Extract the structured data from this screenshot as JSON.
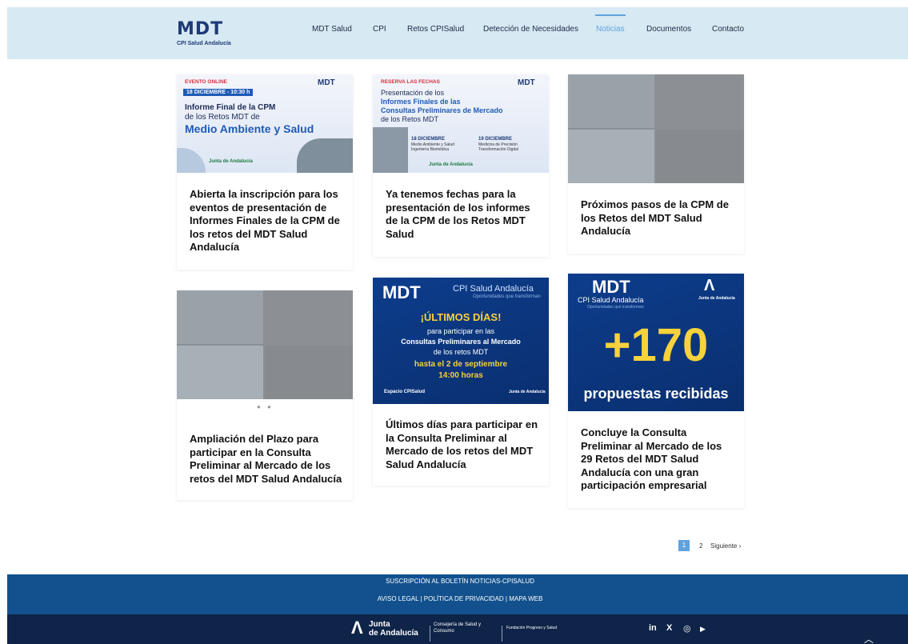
{
  "header": {
    "logo_text": "MDT",
    "logo_subtitle": "CPI Salud Andalucía",
    "nav": [
      {
        "label": "MDT Salud"
      },
      {
        "label": "CPI"
      },
      {
        "label": "Retos CPISalud"
      },
      {
        "label": "Detección de Necesidades"
      },
      {
        "label": "Noticias"
      },
      {
        "label": "Documentos"
      },
      {
        "label": "Contacto"
      }
    ]
  },
  "cards": [
    {
      "title": "Abierta la inscripción para los eventos de presentación de Informes Finales de la CPM de los retos del MDT Salud Andalucía",
      "image": {
        "tag": "EVENTO ONLINE",
        "date": "18 DICIEMBRE - 10:30 h",
        "line1": "Informe Final de la CPM",
        "line2": "de los Retos MDT de",
        "line3": "Medio Ambiente y Salud",
        "brand": "MDT",
        "footer": "Junta de Andalucía"
      }
    },
    {
      "title": "Ya tenemos fechas para la presentación de los informes de la CPM de los Retos MDT Salud",
      "image": {
        "tag": "RESERVA LAS FECHAS",
        "line1": "Presentación de los",
        "line2": "Informes Finales de las",
        "line3": "Consultas Preliminares de Mercado",
        "line4": "de los Retos MDT",
        "date_a": "18 DICIEMBRE",
        "date_a_sub": "Medio Ambiente y Salud",
        "date_a_sub2": "Ingeniería Biomédica",
        "date_b": "19 DICIEMBRE",
        "date_b_sub": "Medicina de Precisión",
        "date_b_sub2": "Transformación Digital",
        "brand": "MDT",
        "footer": "Junta de Andalucía"
      }
    },
    {
      "title": "Próximos pasos de la CPM de los Retos del MDT Salud Andalucía"
    },
    {
      "title": "Ampliación del Plazo para participar en la Consulta Preliminar al Mercado de los retos del MDT Salud Andalucía",
      "dots": "● ●"
    },
    {
      "title": "Últimos días para participar en la Consulta Preliminar al Mercado de los retos del MDT Salud Andalucía",
      "image": {
        "brand": "MDT",
        "brand_sub": "CPI Salud Andalucía",
        "brand_sub2": "Oportunidades que transforman",
        "line1": "¡ÚLTIMOS DÍAS!",
        "line2": "para participar en las",
        "line3": "Consultas Preliminares al Mercado",
        "line4": "de los retos MDT",
        "line5": "hasta el 2 de septiembre",
        "line6": "14:00 horas",
        "footer_left": "Espacio CPISalud",
        "footer_right": "Junta de Andalucía"
      }
    },
    {
      "title": "Concluye la Consulta Preliminar al Mercado de los 29 Retos del MDT Salud Andalucía con una gran participación empresarial",
      "image": {
        "brand": "MDT",
        "brand_sub": "CPI Salud Andalucía",
        "brand_sub2": "Oportunidades que transforman",
        "junta": "Junta de Andalucía",
        "big_number": "+170",
        "caption": "propuestas recibidas"
      }
    }
  ],
  "pagination": {
    "current": "1",
    "next_page": "2",
    "next_label": "Siguiente ›"
  },
  "footer": {
    "newsletter": "SUSCRIPCIÓN AL BOLETÍN NOTICIAS-CPISALUD",
    "links": "AVISO LEGAL | POLÍTICA DE PRIVACIDAD | MAPA WEB",
    "junta_line1": "Junta",
    "junta_line2": "de Andalucía",
    "consejeria_line1": "Consejería de Salud y",
    "consejeria_line2": "Consumo",
    "fundacion": "Fundación Progreso y Salud",
    "social": [
      "in",
      "X",
      "◎",
      "▶"
    ]
  },
  "colors": {
    "header_bg": "#d7e9f3",
    "accent": "#5fa3dd",
    "footer_top": "#12518d",
    "footer_bottom": "#0e2448"
  },
  "icons": [
    "linkedin-icon",
    "x-icon",
    "instagram-icon",
    "youtube-icon",
    "scroll-top-icon"
  ]
}
